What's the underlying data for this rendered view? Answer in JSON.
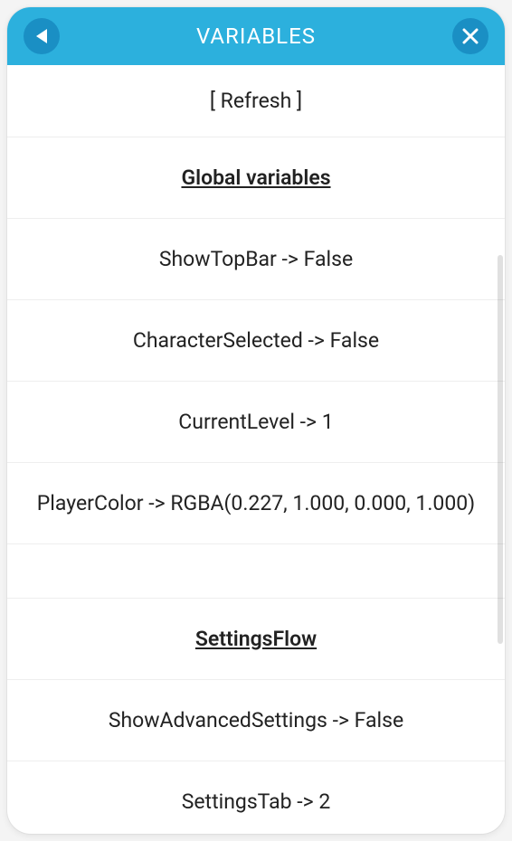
{
  "header": {
    "title": "VARIABLES"
  },
  "refresh": {
    "label": "[ Refresh ]"
  },
  "sections": {
    "global": {
      "heading": "Global variables",
      "items": [
        "ShowTopBar -> False",
        "CharacterSelected -> False",
        "CurrentLevel -> 1",
        "PlayerColor -> RGBA(0.227, 1.000, 0.000, 1.000)"
      ]
    },
    "settingsFlow": {
      "heading": "SettingsFlow",
      "items": [
        "ShowAdvancedSettings -> False",
        "SettingsTab -> 2"
      ]
    }
  }
}
